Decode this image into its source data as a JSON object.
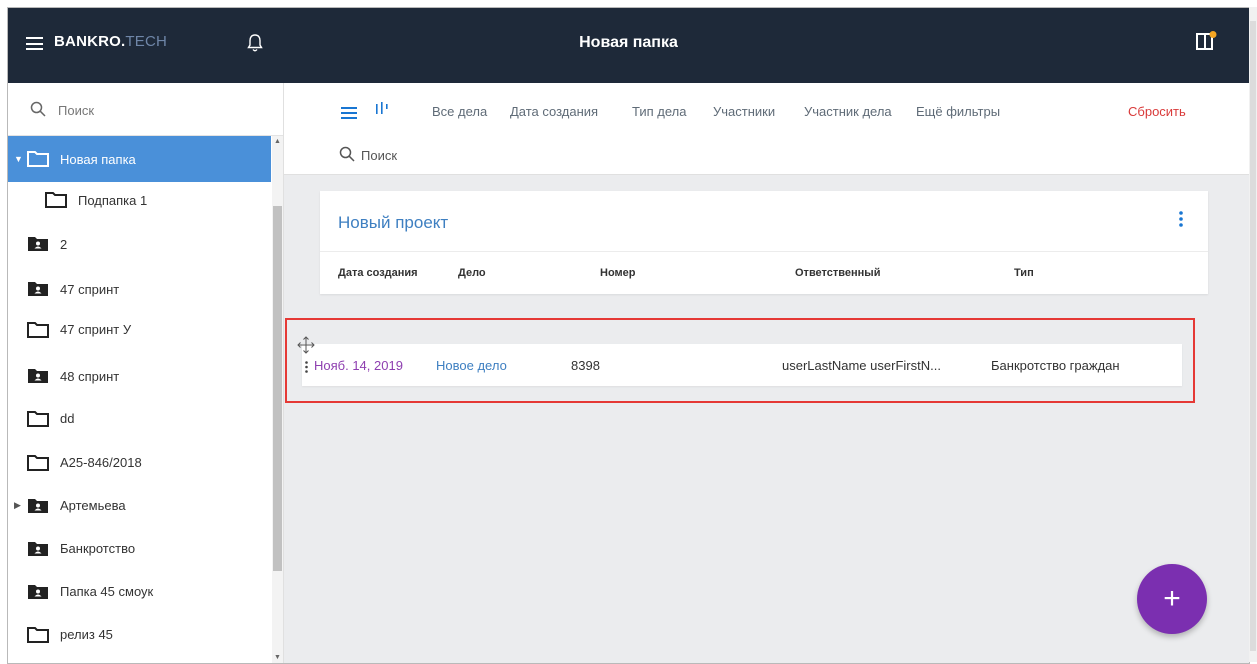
{
  "header": {
    "brand_main": "BANKRO.",
    "brand_sub": "TECH",
    "title": "Новая папка"
  },
  "sidebar": {
    "search_placeholder": "Поиск",
    "items": [
      {
        "label": "Новая папка",
        "icon": "folder-icon",
        "selected": true,
        "expanded": true
      },
      {
        "label": "Подпапка 1",
        "icon": "folder-icon"
      },
      {
        "label": "2",
        "icon": "shared-folder-icon"
      },
      {
        "label": "47 спринт",
        "icon": "shared-folder-icon"
      },
      {
        "label": "47 спринт У",
        "icon": "folder-icon"
      },
      {
        "label": "48 спринт",
        "icon": "shared-folder-icon"
      },
      {
        "label": "dd",
        "icon": "folder-icon"
      },
      {
        "label": "A25-846/2018",
        "icon": "folder-icon"
      },
      {
        "label": "Артемьева",
        "icon": "shared-folder-icon",
        "collapsed": true
      },
      {
        "label": "Банкротство",
        "icon": "shared-folder-icon"
      },
      {
        "label": "Папка 45 смоук",
        "icon": "shared-folder-icon"
      },
      {
        "label": "релиз 45",
        "icon": "folder-icon"
      }
    ]
  },
  "filters": {
    "items": [
      "Все дела",
      "Дата создания",
      "Тип дела",
      "Участники",
      "Участник дела",
      "Ещё фильтры"
    ],
    "reset": "Сбросить",
    "search_placeholder": "Поиск"
  },
  "project": {
    "title": "Новый проект",
    "columns": [
      "Дата создания",
      "Дело",
      "Номер",
      "Ответственный",
      "Тип"
    ],
    "rows": [
      {
        "date": "Нояб. 14, 2019",
        "case": "Новое дело",
        "number": "8398",
        "responsible": "userLastName userFirstN...",
        "type": "Банкротство граждан"
      }
    ]
  },
  "fab": {
    "label": "+"
  },
  "colors": {
    "header_bg": "#1e2939",
    "selected": "#4a90d9",
    "accent_purple": "#7b2fb0",
    "reset_red": "#d93a3a",
    "highlight_border": "#e53935"
  }
}
